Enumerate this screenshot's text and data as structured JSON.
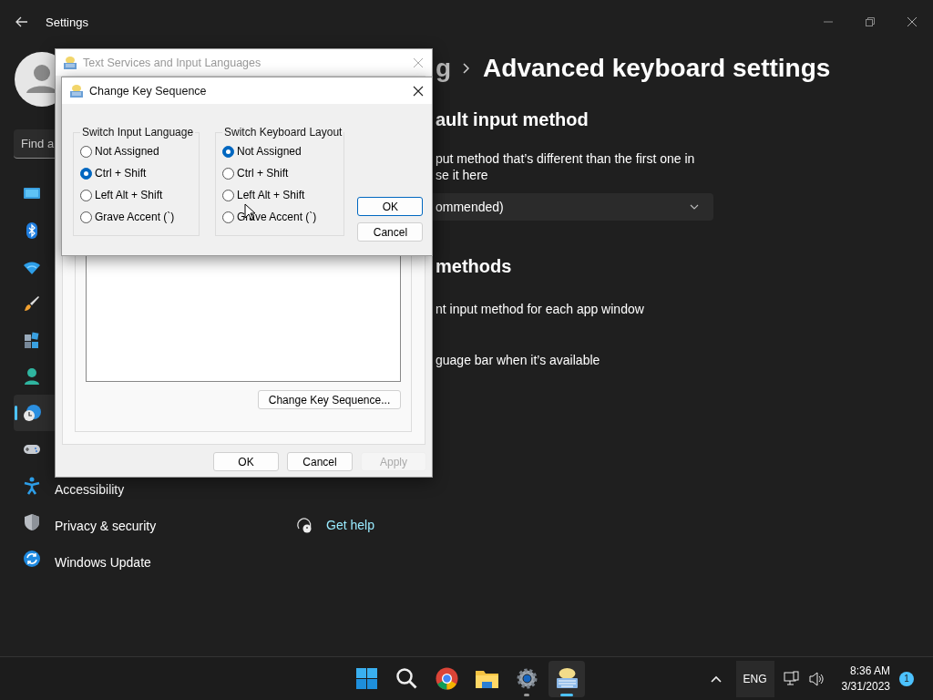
{
  "settings": {
    "title": "Settings",
    "search": {
      "placeholder": "Find a"
    },
    "nav": [
      {
        "selected": false
      },
      {
        "selected": false
      },
      {
        "selected": false
      },
      {
        "selected": false
      },
      {
        "selected": false
      },
      {
        "selected": false
      },
      {
        "selected": true
      },
      {
        "selected": false
      },
      {
        "label": "Accessibility",
        "selected": false
      },
      {
        "label": "Privacy & security",
        "selected": false
      },
      {
        "label": "Windows Update",
        "selected": false
      }
    ],
    "breadcrumb_parent": "g",
    "page_title": "Advanced keyboard settings",
    "sections": [
      {
        "heading": "ault input method",
        "description": [
          "put method that’s different than the first one in",
          "se it here"
        ],
        "dropdown": "ommended)"
      },
      {
        "heading": "methods",
        "options": [
          "nt input method for each app window",
          "guage bar when it’s available"
        ]
      }
    ],
    "help_link": "Get help"
  },
  "back_dialog": {
    "title": "Text Services and Input Languages",
    "active": false,
    "sequence_button": "Change Key Sequence...",
    "buttons": [
      {
        "label": "OK",
        "disabled": false
      },
      {
        "label": "Cancel",
        "disabled": false
      },
      {
        "label": "Apply",
        "disabled": true
      }
    ]
  },
  "front_dialog": {
    "title": "Change Key Sequence",
    "groups": [
      {
        "title": "Switch Input Language",
        "options": [
          {
            "label": "Not Assigned",
            "selected": false
          },
          {
            "label": "Ctrl + Shift",
            "selected": true
          },
          {
            "label": "Left Alt + Shift",
            "selected": false
          },
          {
            "label": "Grave Accent (`)",
            "selected": false
          }
        ]
      },
      {
        "title": "Switch Keyboard Layout",
        "options": [
          {
            "label": "Not Assigned",
            "selected": true
          },
          {
            "label": "Ctrl + Shift",
            "selected": false
          },
          {
            "label": "Left Alt + Shift",
            "selected": false
          },
          {
            "label": "Grave Accent (`)",
            "selected": false
          }
        ]
      }
    ],
    "buttons": [
      {
        "label": "OK",
        "default": true
      },
      {
        "label": "Cancel",
        "default": false
      }
    ]
  },
  "taskbar": {
    "apps": [
      {
        "running": false,
        "active": false
      },
      {
        "running": false,
        "active": false
      },
      {
        "running": false,
        "active": false
      },
      {
        "running": false,
        "active": false
      },
      {
        "running": true,
        "active": false
      },
      {
        "running": true,
        "active": true
      }
    ],
    "language": "ENG",
    "time": "8:36 AM",
    "date": "3/31/2023",
    "notifications": "1"
  }
}
